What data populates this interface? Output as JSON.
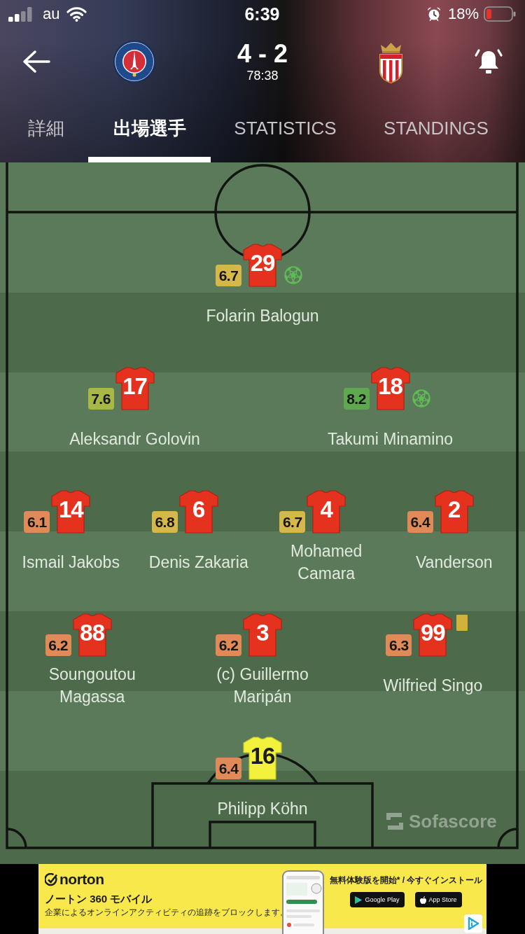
{
  "status_bar": {
    "carrier": "au",
    "time": "6:39",
    "battery": "18%"
  },
  "match": {
    "score": "4 - 2",
    "clock": "78:38"
  },
  "tabs": [
    {
      "label": "詳細",
      "selected": false
    },
    {
      "label": "出場選手",
      "selected": true
    },
    {
      "label": "STATISTICS",
      "selected": false
    },
    {
      "label": "STANDINGS",
      "selected": false
    }
  ],
  "lineup": {
    "rows": [
      {
        "players": [
          {
            "number": "29",
            "name": "Folarin Balogun",
            "rating": "6.7",
            "color": "#d6b84a",
            "kind": "outfield",
            "goal": true,
            "yellow_card": false
          }
        ]
      },
      {
        "players": [
          {
            "number": "17",
            "name": "Aleksandr Golovin",
            "rating": "7.6",
            "color": "#a9b845",
            "kind": "outfield",
            "goal": false,
            "yellow_card": false
          },
          {
            "number": "18",
            "name": "Takumi Minamino",
            "rating": "8.2",
            "color": "#5ea94f",
            "kind": "outfield",
            "goal": true,
            "yellow_card": false
          }
        ]
      },
      {
        "players": [
          {
            "number": "14",
            "name": "Ismail Jakobs",
            "rating": "6.1",
            "color": "#e08a58",
            "kind": "outfield",
            "goal": false,
            "yellow_card": false
          },
          {
            "number": "6",
            "name": "Denis Zakaria",
            "rating": "6.8",
            "color": "#d6b84a",
            "kind": "outfield",
            "goal": false,
            "yellow_card": false
          },
          {
            "number": "4",
            "name": "Mohamed Camara",
            "rating": "6.7",
            "color": "#d6b84a",
            "kind": "outfield",
            "goal": false,
            "yellow_card": false
          },
          {
            "number": "2",
            "name": "Vanderson",
            "rating": "6.4",
            "color": "#e08a58",
            "kind": "outfield",
            "goal": false,
            "yellow_card": false
          }
        ]
      },
      {
        "players": [
          {
            "number": "88",
            "name": "Soungoutou Magassa",
            "rating": "6.2",
            "color": "#e08a58",
            "kind": "outfield",
            "goal": false,
            "yellow_card": false
          },
          {
            "number": "3",
            "name": "(c) Guillermo Maripán",
            "rating": "6.2",
            "color": "#e08a58",
            "kind": "outfield",
            "goal": false,
            "yellow_card": false
          },
          {
            "number": "99",
            "name": "Wilfried Singo",
            "rating": "6.3",
            "color": "#e08a58",
            "kind": "outfield",
            "goal": false,
            "yellow_card": true
          }
        ]
      },
      {
        "players": [
          {
            "number": "16",
            "name": "Philipp Köhn",
            "rating": "6.4",
            "color": "#e08a58",
            "kind": "goalkeeper",
            "goal": false,
            "yellow_card": false
          }
        ]
      }
    ],
    "brand": "Sofascore"
  },
  "ad": {
    "brand": "norton",
    "title": "ノートン 360 モバイル",
    "subtitle": "企業によるオンラインアクティビティの追跡をブロックします。",
    "cta": "無料体験版を開始* / 今すぐインストール",
    "stores": [
      {
        "label": "Google Play",
        "kind": "google"
      },
      {
        "label": "App Store",
        "kind": "apple"
      }
    ]
  }
}
